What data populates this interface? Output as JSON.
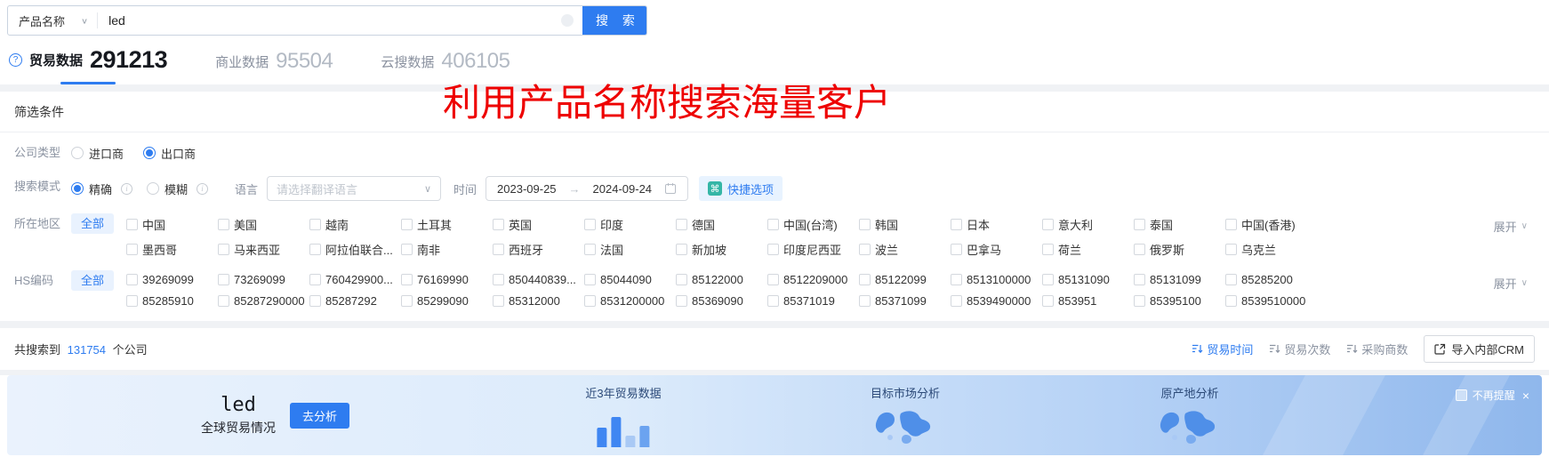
{
  "search": {
    "category_label": "产品名称",
    "query": "led",
    "button_label": "搜 索"
  },
  "tabs": [
    {
      "label": "贸易数据",
      "count": "291213"
    },
    {
      "label": "商业数据",
      "count": "95504"
    },
    {
      "label": "云搜数据",
      "count": "406105"
    }
  ],
  "overlay_text": "利用产品名称搜索海量客户",
  "filters": {
    "title": "筛选条件",
    "company_type": {
      "label": "公司类型",
      "importer": "进口商",
      "exporter": "出口商",
      "selected": "出口商"
    },
    "search_mode": {
      "label": "搜索模式",
      "exact": "精确",
      "fuzzy": "模糊",
      "selected": "精确"
    },
    "language": {
      "label": "语言",
      "placeholder": "请选择翻译语言"
    },
    "time": {
      "label": "时间",
      "start": "2023-09-25",
      "arrow": "→",
      "end": "2024-09-24"
    },
    "quick_options_label": "快捷选项",
    "region": {
      "label": "所在地区",
      "all_label": "全部",
      "expand_label": "展开",
      "row1": [
        "中国",
        "美国",
        "越南",
        "土耳其",
        "英国",
        "印度",
        "德国",
        "中国(台湾)",
        "韩国",
        "日本",
        "意大利",
        "泰国",
        "中国(香港)"
      ],
      "row2": [
        "墨西哥",
        "马来西亚",
        "阿拉伯联合...",
        "南非",
        "西班牙",
        "法国",
        "新加坡",
        "印度尼西亚",
        "波兰",
        "巴拿马",
        "荷兰",
        "俄罗斯",
        "乌克兰"
      ]
    },
    "hs_code": {
      "label": "HS编码",
      "all_label": "全部",
      "expand_label": "展开",
      "row1": [
        "39269099",
        "73269099",
        "760429900...",
        "76169990",
        "850440839...",
        "85044090",
        "85122000",
        "8512209000",
        "85122099",
        "8513100000",
        "85131090",
        "85131099",
        "85285200"
      ],
      "row2": [
        "85285910",
        "85287290000",
        "85287292",
        "85299090",
        "85312000",
        "8531200000",
        "85369090",
        "85371019",
        "85371099",
        "8539490000",
        "853951",
        "85395100",
        "8539510000"
      ]
    }
  },
  "results": {
    "prefix": "共搜索到",
    "count": "131754",
    "suffix": "个公司",
    "sorts": [
      {
        "label": "贸易时间"
      },
      {
        "label": "贸易次数"
      },
      {
        "label": "采购商数"
      }
    ],
    "crm_button_label": "导入内部CRM"
  },
  "banner": {
    "keyword": "led",
    "subtitle": "全球贸易情况",
    "analyze_label": "去分析",
    "cards": [
      {
        "title": "近3年贸易数据"
      },
      {
        "title": "目标市场分析"
      },
      {
        "title": "原产地分析"
      }
    ],
    "dismiss_label": "不再提醒",
    "close_label": "×"
  },
  "colors": {
    "primary_blue": "#2e7cf0",
    "overlay_red": "#ee0000",
    "quick_icon_teal": "#35b6a6",
    "banner_bar_dark": "#3f86f2",
    "banner_bar_light": "#a9c9f5"
  }
}
